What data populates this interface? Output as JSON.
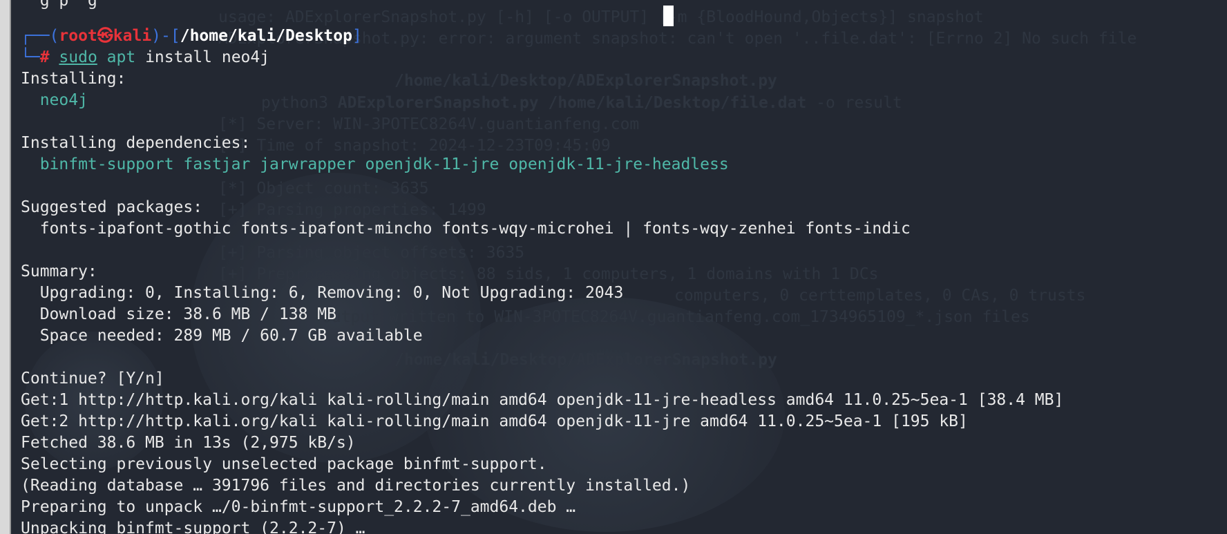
{
  "prompt": {
    "user": "root",
    "skull": "㉿",
    "host": "kali",
    "cwd": "/home/kali/Desktop",
    "symbol": "#",
    "cmd_sudo": "sudo",
    "cmd_apt": "apt",
    "cmd_args": " install neo4j"
  },
  "output": {
    "installing_header": "Installing:",
    "installing_pkgs": "  neo4j",
    "deps_header": "Installing dependencies:",
    "deps_pkgs": "  binfmt-support fastjar jarwrapper openjdk-11-jre openjdk-11-jre-headless",
    "suggested_header": "Suggested packages:",
    "suggested_pkgs": "  fonts-ipafont-gothic fonts-ipafont-mincho fonts-wqy-microhei | fonts-wqy-zenhei fonts-indic",
    "summary_header": "Summary:",
    "summary_1": "  Upgrading: 0, Installing: 6, Removing: 0, Not Upgrading: 2043",
    "summary_2": "  Download size: 38.6 MB / 138 MB",
    "summary_3": "  Space needed: 289 MB / 60.7 GB available",
    "continue": "Continue? [Y/n]",
    "get1": "Get:1 http://http.kali.org/kali kali-rolling/main amd64 openjdk-11-jre-headless amd64 11.0.25~5ea-1 [38.4 MB]",
    "get2": "Get:2 http://http.kali.org/kali kali-rolling/main amd64 openjdk-11-jre amd64 11.0.25~5ea-1 [195 kB]",
    "fetched": "Fetched 38.6 MB in 13s (2,975 kB/s)",
    "selecting": "Selecting previously unselected package binfmt-support.",
    "reading": "(Reading database … 391796 files and directories currently installed.)",
    "preparing": "Preparing to unpack …/0-binfmt-support_2.2.2-7_amd64.deb …",
    "unpacking": "Unpacking binfmt-support (2.2.2-7) …"
  },
  "ghost": {
    "l1": "usage: ADExplorerSnapshot.py [-h] [-o OUTPUT] [-m {BloodHound,Objects}] snapshot",
    "l2": "ADExplorerSnapshot.py: error: argument snapshot: can't open '..file.dat': [Errno 2] No such file",
    "l3": "/home/kali/Desktop/ADExplorerSnapshot.py",
    "l4a": "python3 ",
    "l4b": "ADExplorerSnapshot.py /home/kali/Desktop/file.dat",
    "l4c": " -o result",
    "l5": "[*] Server: WIN-3POTEC8264V.guantianfeng.com",
    "l6": "[*] Time of snapshot: 2024-12-23T09:45:09",
    "l7": "[*] Object count: 3635",
    "l8": "[+] Parsing properties: 1499",
    "l9": "[+] Parsing object offsets: 3635",
    "l10": "[+] Preprocessing objects: 88 sids, 1 computers, 1 domains with 1 DCs",
    "l11": "computers, 0 certtemplates, 0 CAs, 0 trusts",
    "l12": "Output written to WIN-3POTEC8264V.guantianfeng.com_1734965109_*.json files",
    "l13": "/home/kali/Desktop/ADExplorerSnapshot.py"
  },
  "colors": {
    "background": "#232832",
    "prompt_bracket": "#3d74e0",
    "prompt_user": "#e8333a",
    "package_text": "#4fb8a8",
    "foreground": "#e8e8e8"
  }
}
